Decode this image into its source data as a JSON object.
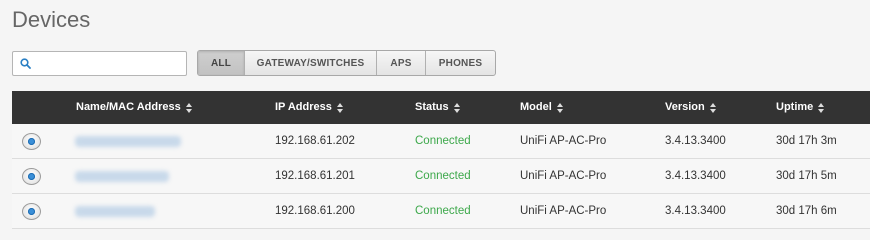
{
  "page": {
    "title": "Devices"
  },
  "search": {
    "placeholder": ""
  },
  "filters": [
    {
      "label": "ALL",
      "active": true
    },
    {
      "label": "GATEWAY/SWITCHES",
      "active": false
    },
    {
      "label": "APS",
      "active": false
    },
    {
      "label": "PHONES",
      "active": false
    }
  ],
  "table": {
    "columns": [
      "Name/MAC Address",
      "IP Address",
      "Status",
      "Model",
      "Version",
      "Uptime"
    ],
    "rows": [
      {
        "name": "",
        "ip": "192.168.61.202",
        "status": "Connected",
        "model": "UniFi AP-AC-Pro",
        "version": "3.4.13.3400",
        "uptime": "30d 17h 3m"
      },
      {
        "name": "",
        "ip": "192.168.61.201",
        "status": "Connected",
        "model": "UniFi AP-AC-Pro",
        "version": "3.4.13.3400",
        "uptime": "30d 17h 5m"
      },
      {
        "name": "",
        "ip": "192.168.61.200",
        "status": "Connected",
        "model": "UniFi AP-AC-Pro",
        "version": "3.4.13.3400",
        "uptime": "30d 17h 6m"
      }
    ]
  },
  "colors": {
    "status_connected": "#3da84b",
    "header_bg": "#333333",
    "accent": "#3a8fd8"
  }
}
